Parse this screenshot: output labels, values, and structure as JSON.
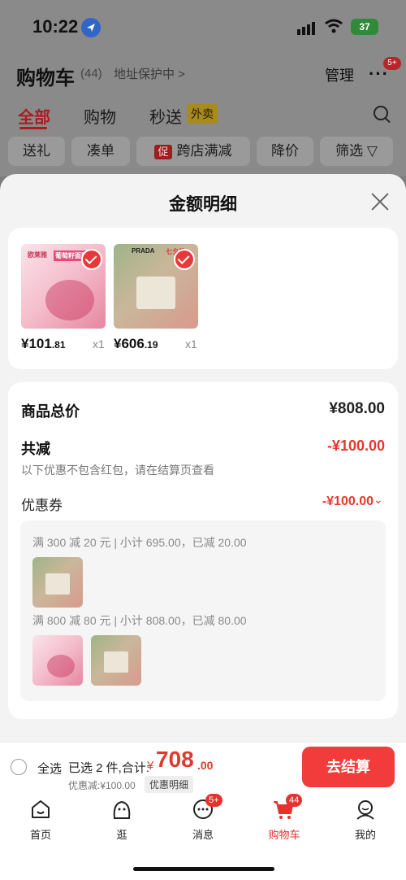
{
  "status": {
    "time": "10:22",
    "battery": "37"
  },
  "header": {
    "title": "购物车",
    "count": "(44)",
    "address": "地址保护中 >",
    "manage": "管理",
    "more_badge": "5+"
  },
  "tabs": [
    {
      "label": "全部"
    },
    {
      "label": "购物"
    },
    {
      "label": "秒送"
    }
  ],
  "tab_tag": "外卖",
  "chips": [
    {
      "label": "送礼"
    },
    {
      "label": "凑单"
    },
    {
      "tag": "促",
      "label": "跨店满减"
    },
    {
      "label": "降价"
    },
    {
      "label": "筛选 ▽"
    }
  ],
  "sheet": {
    "title": "金额明细",
    "products": [
      {
        "price_main": "¥101",
        "price_dec": ".81",
        "qty": "x1",
        "img_text": "欧莱雅",
        "img_tag": "葡萄籽面膜"
      },
      {
        "price_main": "¥606",
        "price_dec": ".19",
        "qty": "x1",
        "img_text": "PRADA",
        "img_tag": "七夕节"
      }
    ],
    "total_label": "商品总价",
    "total_value": "¥808.00",
    "discount_label": "共减",
    "discount_value": "-¥100.00",
    "discount_note": "以下优惠不包含红包，请在结算页查看",
    "coupon_label": "优惠券",
    "coupon_value": "-¥100.00",
    "coupon_rules": [
      {
        "condition": "满 300 减 20 元 | 小计 695.00，已减 20.00"
      },
      {
        "condition": "满 800 减 80 元 | 小计 808.00，已减 80.00"
      }
    ]
  },
  "bottom": {
    "select_all": "全选",
    "selected": "已选 2 件,合计:",
    "currency": "¥",
    "total_main": "708",
    "total_dec": ".00",
    "discount": "优惠减:¥100.00",
    "detail_btn": "优惠明细",
    "checkout": "去结算"
  },
  "tabbar": [
    {
      "label": "首页",
      "icon": "home-icon"
    },
    {
      "label": "逛",
      "icon": "browse-icon"
    },
    {
      "label": "消息",
      "icon": "message-icon",
      "badge": "5+"
    },
    {
      "label": "购物车",
      "icon": "cart-icon",
      "badge": "44",
      "active": true
    },
    {
      "label": "我的",
      "icon": "profile-icon"
    }
  ]
}
